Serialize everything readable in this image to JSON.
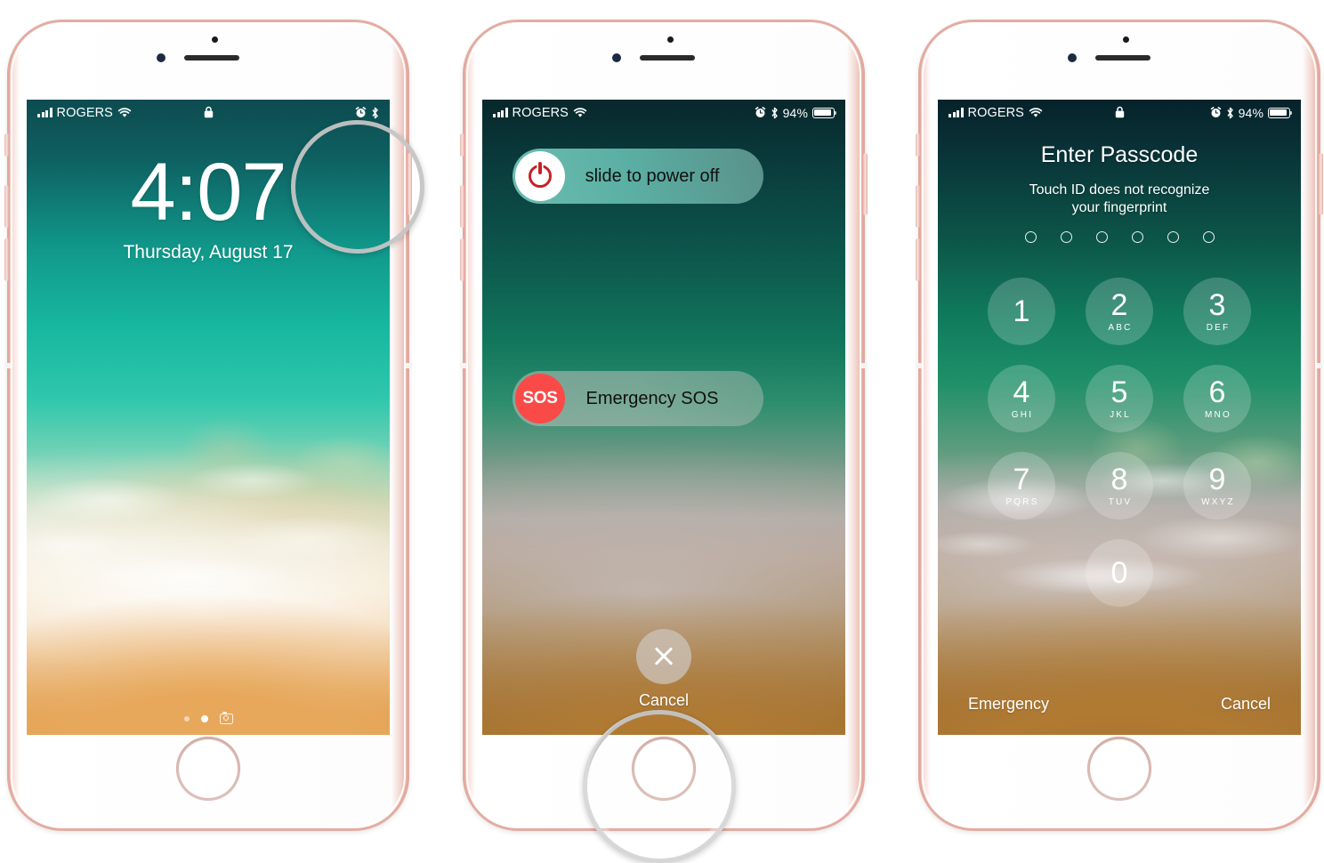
{
  "page": {
    "title": "iPhone force restart / enter passcode walkthrough",
    "phone_color": "#e2a99e",
    "accent_red": "#c62026",
    "sos_red": "#fa4a47"
  },
  "status_bar": {
    "carrier": "ROGERS",
    "wifi_icon": "wifi-icon",
    "signal_icon": "cellular-signal-icon",
    "lock_icon": "lock-icon",
    "alarm_icon": "alarm-clock-icon",
    "bluetooth_icon": "bluetooth-icon",
    "battery_percent": "94%",
    "battery_level": 94
  },
  "phones": [
    {
      "id": "phone-1",
      "name": "lock-screen-phone",
      "screen": "lock-screen",
      "status_center_icon": "lock-icon",
      "shows_battery_percent": false,
      "lock": {
        "time": "4:07",
        "date": "Thursday, August 17",
        "page_dots": 3,
        "active_dot_index": 1,
        "camera_icon": "camera-icon"
      },
      "callout": {
        "name": "power-button-callout",
        "target": "sleep-wake-button"
      }
    },
    {
      "id": "phone-2",
      "name": "power-off-phone",
      "screen": "power-off-screen",
      "status_center_icon": "none",
      "shows_battery_percent": true,
      "power_off": {
        "slide_label": "slide to power off",
        "slide_icon": "power-icon",
        "sos_label": "Emergency SOS",
        "sos_icon": "SOS",
        "cancel_label": "Cancel",
        "cancel_icon": "close-x-icon"
      },
      "callout": {
        "name": "home-button-callout",
        "target": "home-button"
      }
    },
    {
      "id": "phone-3",
      "name": "passcode-phone",
      "screen": "passcode-screen",
      "status_center_icon": "lock-icon",
      "shows_battery_percent": true,
      "passcode": {
        "title": "Enter Passcode",
        "subtitle": "Touch ID does not recognize\nyour fingerprint",
        "subtitle_line1": "Touch ID does not recognize",
        "subtitle_line2": "your fingerprint",
        "dot_count": 6,
        "filled_dots": 0,
        "keys": [
          {
            "num": "1",
            "letters": ""
          },
          {
            "num": "2",
            "letters": "ABC"
          },
          {
            "num": "3",
            "letters": "DEF"
          },
          {
            "num": "4",
            "letters": "GHI"
          },
          {
            "num": "5",
            "letters": "JKL"
          },
          {
            "num": "6",
            "letters": "MNO"
          },
          {
            "num": "7",
            "letters": "PQRS"
          },
          {
            "num": "8",
            "letters": "TUV"
          },
          {
            "num": "9",
            "letters": "WXYZ"
          },
          {
            "num": "0",
            "letters": ""
          }
        ],
        "emergency_label": "Emergency",
        "cancel_label": "Cancel"
      },
      "callout": null
    }
  ]
}
